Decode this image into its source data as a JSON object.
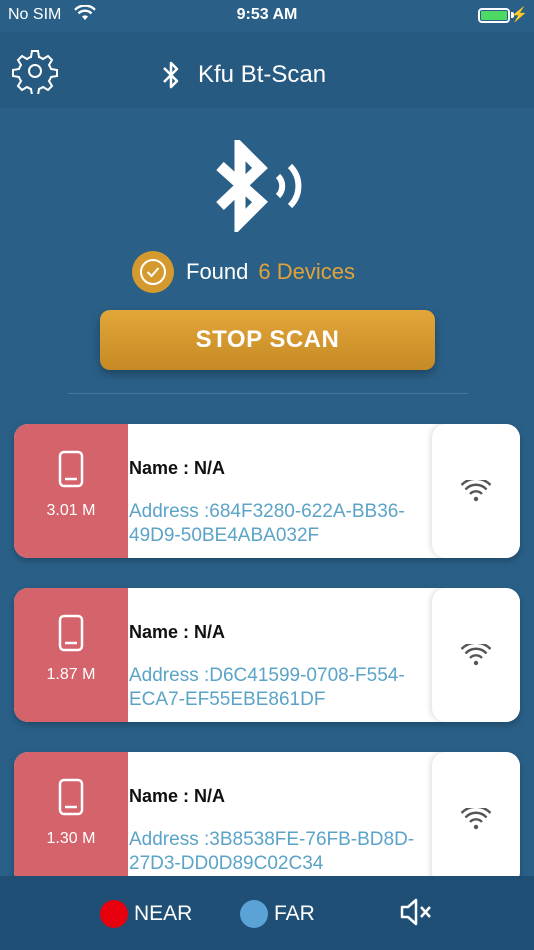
{
  "status_bar": {
    "carrier": "No SIM",
    "time": "9:53 AM"
  },
  "header": {
    "title": "Kfu Bt-Scan",
    "settings_icon": "gear-icon",
    "bt_icon": "bluetooth-icon"
  },
  "scan": {
    "found_label": "Found",
    "found_count": "6 Devices",
    "stop_label": "STOP SCAN"
  },
  "devices": [
    {
      "distance": "3.01 M",
      "name": "Name : N/A",
      "address": "Address :684F3280-622A-BB36-49D9-50BE4ABA032F"
    },
    {
      "distance": "1.87 M",
      "name": "Name : N/A",
      "address": "Address :D6C41599-0708-F554-ECA7-EF55EBE861DF"
    },
    {
      "distance": "1.30 M",
      "name": "Name : N/A",
      "address": "Address :3B8538FE-76FB-BD8D-27D3-DD0D89C02C34"
    }
  ],
  "legend": {
    "near_label": "NEAR",
    "far_label": "FAR",
    "near_color": "#e8000f",
    "far_color": "#5ba3d6"
  },
  "colors": {
    "background": "#2a6088",
    "accent": "#e0a33a",
    "card_left": "#d4636b",
    "address": "#5ba3c7"
  }
}
